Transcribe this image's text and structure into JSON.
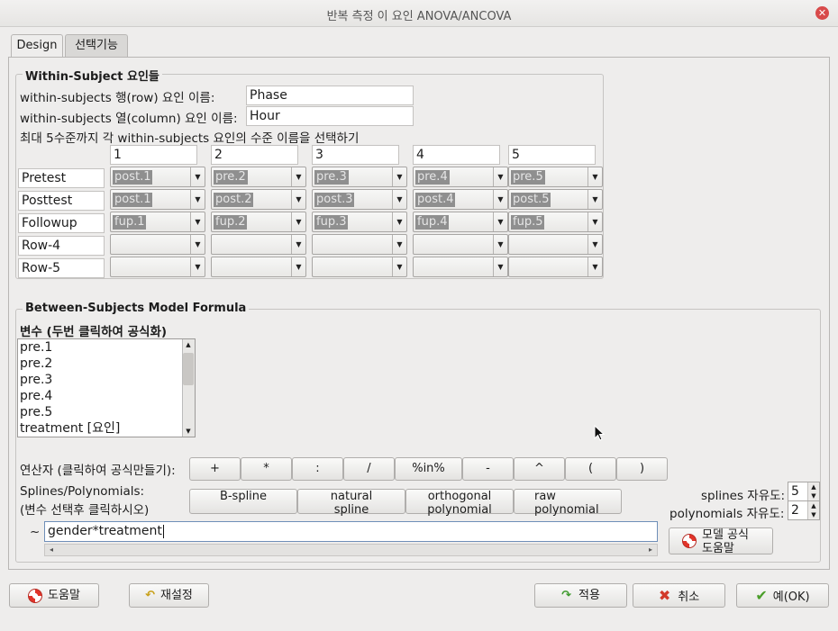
{
  "window": {
    "title": "반복 측정 이 요인 ANOVA/ANCOVA",
    "close_glyph": "✕"
  },
  "tabs": [
    {
      "label": "Design"
    },
    {
      "label": "선택기능"
    }
  ],
  "within": {
    "legend": "Within-Subject 요인들",
    "row_factor_label": "within-subjects 행(row) 요인 이름:",
    "row_factor_value": "Phase",
    "col_factor_label": "within-subjects 열(column) 요인 이름:",
    "col_factor_value": "Hour",
    "levels_label": "최대 5수준까지 각 within-subjects 요인의 수준 이름을 선택하기",
    "col_levels": [
      "1",
      "2",
      "3",
      "4",
      "5"
    ],
    "rows": [
      {
        "name": "Pretest",
        "cells": [
          "post.1",
          "pre.2",
          "pre.3",
          "pre.4",
          "pre.5"
        ]
      },
      {
        "name": "Posttest",
        "cells": [
          "post.1",
          "post.2",
          "post.3",
          "post.4",
          "post.5"
        ]
      },
      {
        "name": "Followup",
        "cells": [
          "fup.1",
          "fup.2",
          "fup.3",
          "fup.4",
          "fup.5"
        ]
      },
      {
        "name": "Row-4",
        "cells": [
          "",
          "",
          "",
          "",
          ""
        ]
      },
      {
        "name": "Row-5",
        "cells": [
          "",
          "",
          "",
          "",
          ""
        ]
      }
    ]
  },
  "between": {
    "legend": "Between-Subjects Model Formula",
    "vars_label": "변수 (두번 클릭하여 공식화)",
    "variables": [
      "pre.1",
      "pre.2",
      "pre.3",
      "pre.4",
      "pre.5",
      "treatment [요인]"
    ],
    "operators_label": "연산자 (클릭하여 공식만들기):",
    "operators": [
      "+",
      "*",
      ":",
      "/",
      "%in%",
      "-",
      "^",
      "(",
      ")"
    ],
    "splines_label_1": "Splines/Polynomials:",
    "splines_label_2": "(변수 선택후 클릭하시오)",
    "spline_buttons": [
      {
        "line1": "B-spline",
        "line2": ""
      },
      {
        "line1": "natural",
        "line2": "spline"
      },
      {
        "line1": "orthogonal",
        "line2": "polynomial"
      },
      {
        "line1": "raw",
        "line2": "polynomial"
      }
    ],
    "splines_df_label": "splines 자유도:",
    "splines_df_value": "5",
    "poly_df_label": "polynomials 자유도:",
    "poly_df_value": "2",
    "tilde": "~",
    "formula": "gender*treatment",
    "formula_help_1": "모델 공식",
    "formula_help_2": "도움말"
  },
  "footer": {
    "help": "도움말",
    "reset": "재설정",
    "apply": "적용",
    "cancel": "취소",
    "ok": "예(OK)"
  }
}
